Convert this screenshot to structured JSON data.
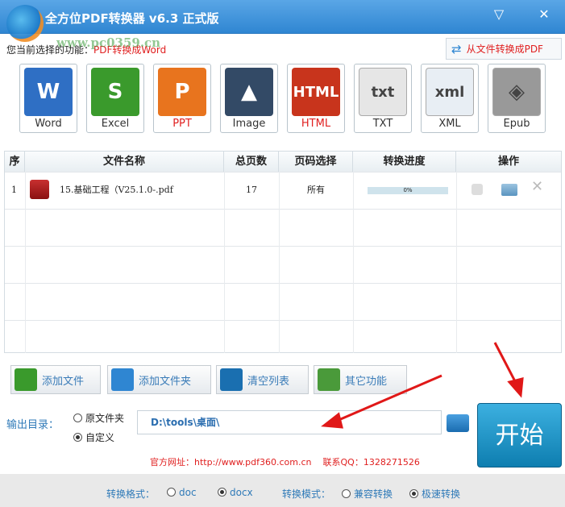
{
  "app": {
    "title": "全方位PDF转换器 v6.3 正式版",
    "watermark": "www.pc0359.cn"
  },
  "window": {
    "menu_icon": "menu-icon",
    "close_icon": "close-icon"
  },
  "function": {
    "label": "您当前选择的功能：",
    "value": "PDF转换成Word"
  },
  "to_pdf_button": "从文件转换成PDF",
  "formats": [
    {
      "label": "Word",
      "glyph": "W",
      "color": "#2f6fc4",
      "selected": true
    },
    {
      "label": "Excel",
      "glyph": "S",
      "color": "#3a9a2c"
    },
    {
      "label": "PPT",
      "glyph": "P",
      "color": "#e8741e"
    },
    {
      "label": "Image",
      "glyph": "▲",
      "color": "#334a66"
    },
    {
      "label": "HTML",
      "glyph": "HTML",
      "color": "#c8341c"
    },
    {
      "label": "TXT",
      "glyph": "txt",
      "color": "#e6e6e6"
    },
    {
      "label": "XML",
      "glyph": "xml",
      "color": "#e8eef4"
    },
    {
      "label": "Epub",
      "glyph": "◈",
      "color": "#999999"
    }
  ],
  "table": {
    "headers": [
      "序",
      "文件名称",
      "总页数",
      "页码选择",
      "转换进度",
      "操作"
    ],
    "rows": [
      {
        "index": "1",
        "name": "15.基础工程（V25.1.0-.pdf",
        "pages": "17",
        "range": "所有",
        "progress": "0%",
        "progress_value": 0
      }
    ]
  },
  "actions": [
    {
      "label": "添加文件",
      "color": "#3a9a2c"
    },
    {
      "label": "添加文件夹",
      "color": "#2f86d2"
    },
    {
      "label": "清空列表",
      "color": "#1a6fb0"
    },
    {
      "label": "其它功能",
      "color": "#4a9a3a"
    }
  ],
  "output": {
    "label": "输出目录：",
    "options": [
      "原文件夹",
      "自定义"
    ],
    "selected": "自定义",
    "path": "D:\\tools\\桌面\\"
  },
  "start_button": "开始",
  "contact": {
    "site": "官方网址：http://www.pdf360.com.cn",
    "qq": "联系QQ：1328271526"
  },
  "footer": {
    "format_label": "转换格式：",
    "formats": [
      "doc",
      "docx"
    ],
    "format_selected": "docx",
    "mode_label": "转换模式：",
    "modes": [
      "兼容转换",
      "极速转换"
    ],
    "mode_selected": "极速转换"
  },
  "colors": {
    "title_bar": "#2f86d2",
    "accent_red": "#e02020",
    "start": "#1a8cc0"
  }
}
